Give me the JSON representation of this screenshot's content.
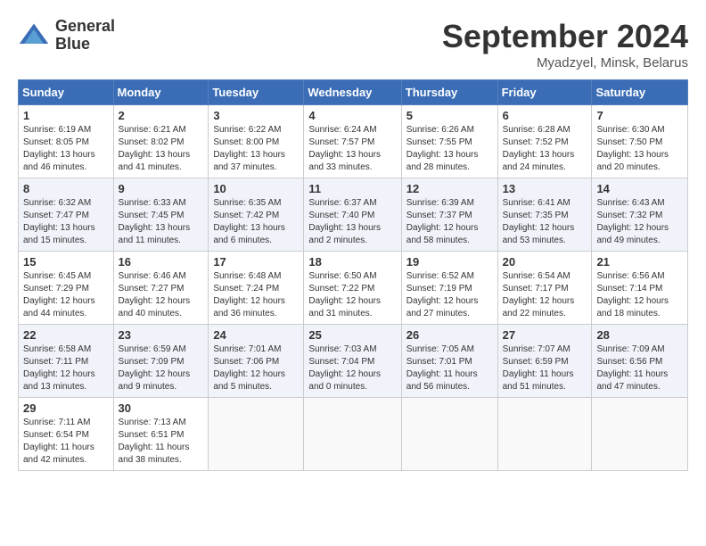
{
  "header": {
    "logo_line1": "General",
    "logo_line2": "Blue",
    "month_title": "September 2024",
    "subtitle": "Myadzyel, Minsk, Belarus"
  },
  "days_of_week": [
    "Sunday",
    "Monday",
    "Tuesday",
    "Wednesday",
    "Thursday",
    "Friday",
    "Saturday"
  ],
  "weeks": [
    [
      {
        "day": "1",
        "info": "Sunrise: 6:19 AM\nSunset: 8:05 PM\nDaylight: 13 hours and 46 minutes."
      },
      {
        "day": "2",
        "info": "Sunrise: 6:21 AM\nSunset: 8:02 PM\nDaylight: 13 hours and 41 minutes."
      },
      {
        "day": "3",
        "info": "Sunrise: 6:22 AM\nSunset: 8:00 PM\nDaylight: 13 hours and 37 minutes."
      },
      {
        "day": "4",
        "info": "Sunrise: 6:24 AM\nSunset: 7:57 PM\nDaylight: 13 hours and 33 minutes."
      },
      {
        "day": "5",
        "info": "Sunrise: 6:26 AM\nSunset: 7:55 PM\nDaylight: 13 hours and 28 minutes."
      },
      {
        "day": "6",
        "info": "Sunrise: 6:28 AM\nSunset: 7:52 PM\nDaylight: 13 hours and 24 minutes."
      },
      {
        "day": "7",
        "info": "Sunrise: 6:30 AM\nSunset: 7:50 PM\nDaylight: 13 hours and 20 minutes."
      }
    ],
    [
      {
        "day": "8",
        "info": "Sunrise: 6:32 AM\nSunset: 7:47 PM\nDaylight: 13 hours and 15 minutes."
      },
      {
        "day": "9",
        "info": "Sunrise: 6:33 AM\nSunset: 7:45 PM\nDaylight: 13 hours and 11 minutes."
      },
      {
        "day": "10",
        "info": "Sunrise: 6:35 AM\nSunset: 7:42 PM\nDaylight: 13 hours and 6 minutes."
      },
      {
        "day": "11",
        "info": "Sunrise: 6:37 AM\nSunset: 7:40 PM\nDaylight: 13 hours and 2 minutes."
      },
      {
        "day": "12",
        "info": "Sunrise: 6:39 AM\nSunset: 7:37 PM\nDaylight: 12 hours and 58 minutes."
      },
      {
        "day": "13",
        "info": "Sunrise: 6:41 AM\nSunset: 7:35 PM\nDaylight: 12 hours and 53 minutes."
      },
      {
        "day": "14",
        "info": "Sunrise: 6:43 AM\nSunset: 7:32 PM\nDaylight: 12 hours and 49 minutes."
      }
    ],
    [
      {
        "day": "15",
        "info": "Sunrise: 6:45 AM\nSunset: 7:29 PM\nDaylight: 12 hours and 44 minutes."
      },
      {
        "day": "16",
        "info": "Sunrise: 6:46 AM\nSunset: 7:27 PM\nDaylight: 12 hours and 40 minutes."
      },
      {
        "day": "17",
        "info": "Sunrise: 6:48 AM\nSunset: 7:24 PM\nDaylight: 12 hours and 36 minutes."
      },
      {
        "day": "18",
        "info": "Sunrise: 6:50 AM\nSunset: 7:22 PM\nDaylight: 12 hours and 31 minutes."
      },
      {
        "day": "19",
        "info": "Sunrise: 6:52 AM\nSunset: 7:19 PM\nDaylight: 12 hours and 27 minutes."
      },
      {
        "day": "20",
        "info": "Sunrise: 6:54 AM\nSunset: 7:17 PM\nDaylight: 12 hours and 22 minutes."
      },
      {
        "day": "21",
        "info": "Sunrise: 6:56 AM\nSunset: 7:14 PM\nDaylight: 12 hours and 18 minutes."
      }
    ],
    [
      {
        "day": "22",
        "info": "Sunrise: 6:58 AM\nSunset: 7:11 PM\nDaylight: 12 hours and 13 minutes."
      },
      {
        "day": "23",
        "info": "Sunrise: 6:59 AM\nSunset: 7:09 PM\nDaylight: 12 hours and 9 minutes."
      },
      {
        "day": "24",
        "info": "Sunrise: 7:01 AM\nSunset: 7:06 PM\nDaylight: 12 hours and 5 minutes."
      },
      {
        "day": "25",
        "info": "Sunrise: 7:03 AM\nSunset: 7:04 PM\nDaylight: 12 hours and 0 minutes."
      },
      {
        "day": "26",
        "info": "Sunrise: 7:05 AM\nSunset: 7:01 PM\nDaylight: 11 hours and 56 minutes."
      },
      {
        "day": "27",
        "info": "Sunrise: 7:07 AM\nSunset: 6:59 PM\nDaylight: 11 hours and 51 minutes."
      },
      {
        "day": "28",
        "info": "Sunrise: 7:09 AM\nSunset: 6:56 PM\nDaylight: 11 hours and 47 minutes."
      }
    ],
    [
      {
        "day": "29",
        "info": "Sunrise: 7:11 AM\nSunset: 6:54 PM\nDaylight: 11 hours and 42 minutes."
      },
      {
        "day": "30",
        "info": "Sunrise: 7:13 AM\nSunset: 6:51 PM\nDaylight: 11 hours and 38 minutes."
      },
      null,
      null,
      null,
      null,
      null
    ]
  ]
}
